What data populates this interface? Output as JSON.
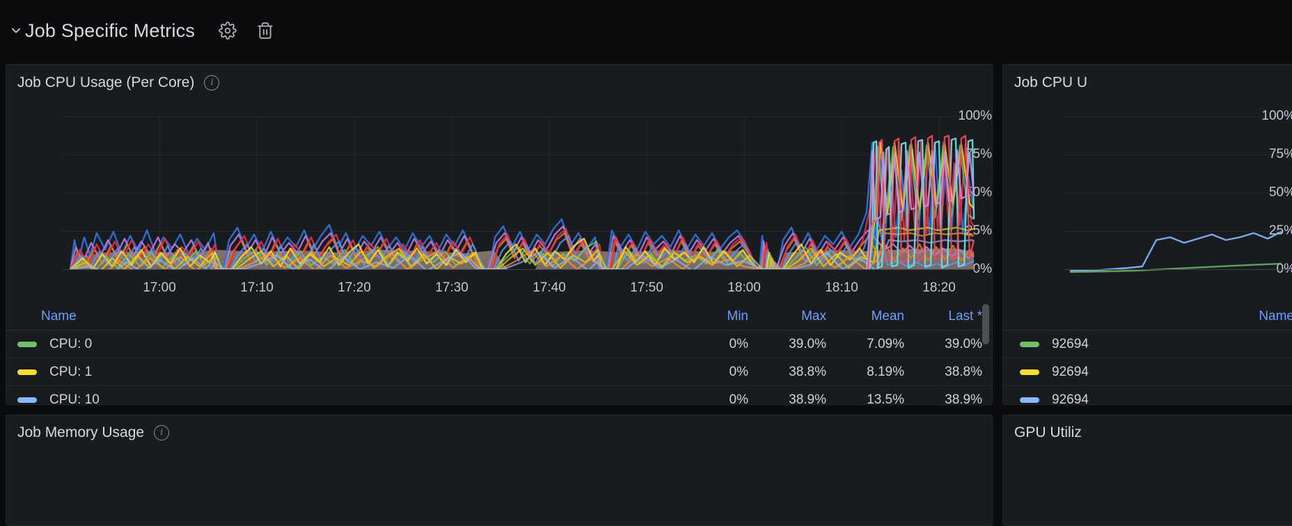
{
  "row": {
    "title": "Job Specific Metrics",
    "collapse_icon": "chevron-down-icon",
    "settings_icon": "gear-icon",
    "delete_icon": "trash-icon"
  },
  "panels": {
    "cpu_per_core": {
      "title": "Job CPU Usage (Per Core)",
      "info_icon": "info-circle-icon",
      "yticks": [
        "100%",
        "75%",
        "50%",
        "25%",
        "0%"
      ],
      "xticks": [
        "17:00",
        "17:10",
        "17:20",
        "17:30",
        "17:40",
        "17:50",
        "18:00",
        "18:10",
        "18:20"
      ],
      "legend": {
        "columns": [
          "Name",
          "Min",
          "Max",
          "Mean",
          "Last *"
        ],
        "rows": [
          {
            "name": "CPU: 0",
            "color": "#73bf69",
            "min": "0%",
            "max": "39.0%",
            "mean": "7.09%",
            "last": "39.0%"
          },
          {
            "name": "CPU: 1",
            "color": "#fade2a",
            "min": "0%",
            "max": "38.8%",
            "mean": "8.19%",
            "last": "38.8%"
          },
          {
            "name": "CPU: 10",
            "color": "#8ab8ff",
            "min": "0%",
            "max": "38.9%",
            "mean": "13.5%",
            "last": "38.9%"
          }
        ]
      }
    },
    "cpu_right": {
      "title": "Job CPU U",
      "yticks": [
        "100%",
        "75%",
        "50%",
        "25%",
        "0%"
      ],
      "legend": {
        "columns": [
          "Name"
        ],
        "rows": [
          {
            "name": "92694",
            "color": "#73bf69"
          },
          {
            "name": "92694",
            "color": "#fade2a"
          },
          {
            "name": "92694",
            "color": "#8ab8ff"
          }
        ]
      }
    },
    "memory": {
      "title": "Job Memory Usage",
      "info_icon": "info-circle-icon"
    },
    "gpu": {
      "title": "GPU Utiliz"
    }
  },
  "chart_data": {
    "type": "line",
    "title": "Job CPU Usage (Per Core)",
    "xlabel": "",
    "ylabel": "",
    "ylim": [
      0,
      100
    ],
    "yticks": [
      0,
      25,
      50,
      75,
      100
    ],
    "x": [
      "17:00",
      "17:10",
      "17:20",
      "17:30",
      "17:40",
      "17:50",
      "18:00",
      "18:10",
      "18:20"
    ],
    "grid": true,
    "legend_position": "bottom-table",
    "series": [
      {
        "name": "CPU: 0",
        "color": "#73bf69",
        "min": 0,
        "max": 39.0,
        "mean": 7.09,
        "last": 39.0
      },
      {
        "name": "CPU: 1",
        "color": "#fade2a",
        "min": 0,
        "max": 38.8,
        "mean": 8.19,
        "last": 38.8
      },
      {
        "name": "CPU: 10",
        "color": "#8ab8ff",
        "min": 0,
        "max": 38.9,
        "mean": 13.5,
        "last": 38.9
      }
    ]
  }
}
